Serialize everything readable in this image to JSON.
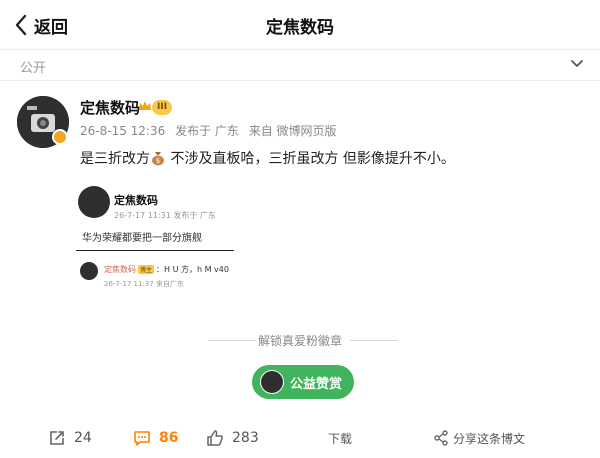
{
  "header": {
    "back_label": "返回",
    "title": "定焦数码"
  },
  "visibility": {
    "label": "公开"
  },
  "post": {
    "author": "定焦数码",
    "level_badge": "III",
    "date": "26-8-15 12:36",
    "location": "发布于 广东",
    "source": "来自 微博网页版",
    "text_part1": "是三折改方",
    "text_part2": " 不涉及直板哈，三折虽改方 但影像提升不小。"
  },
  "quoted_screenshot": {
    "author": "定焦数码",
    "meta": "26-7-17 11:31 发布于 广东",
    "text": "华为荣耀都要把一部分旗舰",
    "comment_author": "定焦数码",
    "comment_badge": "博主",
    "comment_text": "：H U 方，h M v40",
    "comment_meta": "26-7-17 11:37 来自广东"
  },
  "fan_badge_text": "解锁真爱粉徽章",
  "reward_button": {
    "label": "公益赞赏"
  },
  "actions": {
    "repost_count": "24",
    "comment_count": "86",
    "like_count": "283",
    "download_label": "下载",
    "share_label": "分享这条博文"
  },
  "colors": {
    "accent_orange": "#ff8200",
    "reward_green": "#3fb45c",
    "badge_gold": "#f7c948"
  }
}
